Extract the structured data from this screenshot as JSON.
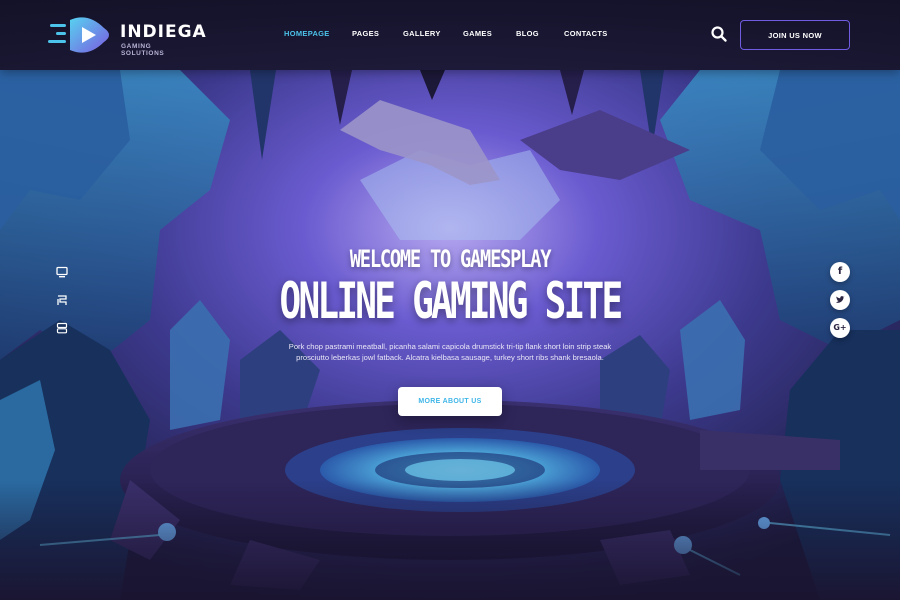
{
  "brand": {
    "name": "INDIEGA",
    "tagline": "GAMING SOLUTIONS",
    "accent": "#4cc3ea",
    "purple": "#6f5ce0"
  },
  "nav": {
    "items": [
      {
        "label": "HOMEPAGE",
        "active": true
      },
      {
        "label": "PAGES",
        "active": false
      },
      {
        "label": "GALLERY",
        "active": false
      },
      {
        "label": "GAMES",
        "active": false
      },
      {
        "label": "BLOG",
        "active": false
      },
      {
        "label": "CONTACTS",
        "active": false
      }
    ]
  },
  "header": {
    "search_icon": "search-icon",
    "join_label": "JOIN US NOW"
  },
  "hero": {
    "subtitle": "WELCOME TO GAMESPLAY",
    "title": "ONLINE GAMING SITE",
    "description": "Pork chop pastrami meatball, picanha salami capicola drumstick tri-tip flank short loin strip steak prosciutto leberkas jowl fatback. Alcatra kielbasa sausage, turkey short ribs shank bresaola.",
    "cta_label": "MORE ABOUT US"
  },
  "side_nav": {
    "icons": [
      "monitor-icon",
      "console-icon",
      "gamepad-icon"
    ]
  },
  "social": [
    {
      "name": "facebook-icon",
      "glyph": "f"
    },
    {
      "name": "twitter-icon",
      "glyph": "t"
    },
    {
      "name": "google-plus-icon",
      "glyph": "G+"
    }
  ]
}
